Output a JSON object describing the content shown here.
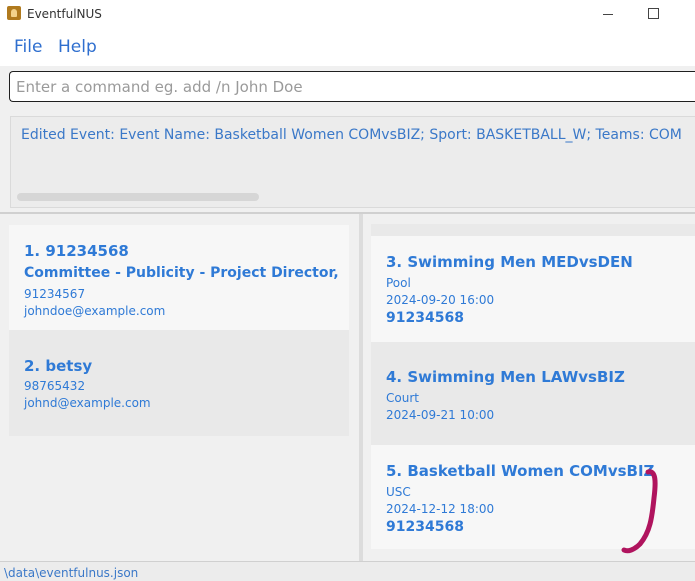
{
  "window": {
    "title": "EventfulNUS"
  },
  "menu": {
    "file": "File",
    "help": "Help"
  },
  "command": {
    "placeholder": "Enter a command eg. add /n John Doe",
    "value": ""
  },
  "result": {
    "text": "Edited Event: Event Name: Basketball Women COMvsBIZ; Sport: BASKETBALL_W; Teams: COM"
  },
  "persons": [
    {
      "title": "1. 91234568",
      "subtitle": "Committee - Publicity - Project Director,",
      "phone": "91234567",
      "email": "johndoe@example.com"
    },
    {
      "title": "2. betsy",
      "phone": "98765432",
      "email": "johnd@example.com"
    }
  ],
  "events": [
    {
      "title": "3. Swimming Men MEDvsDEN",
      "venue": "Pool",
      "datetime": "2024-09-20 16:00",
      "extra": "91234568"
    },
    {
      "title": "4. Swimming Men LAWvsBIZ",
      "venue": "Court",
      "datetime": "2024-09-21 10:00"
    },
    {
      "title": "5. Basketball Women COMvsBIZ",
      "venue": "USC",
      "datetime": "2024-12-12 18:00",
      "extra": "91234568"
    }
  ],
  "status": {
    "path": "\\data\\eventfulnus.json"
  },
  "colors": {
    "accent": "#2f7ad6",
    "annotation": "#b0145e"
  }
}
